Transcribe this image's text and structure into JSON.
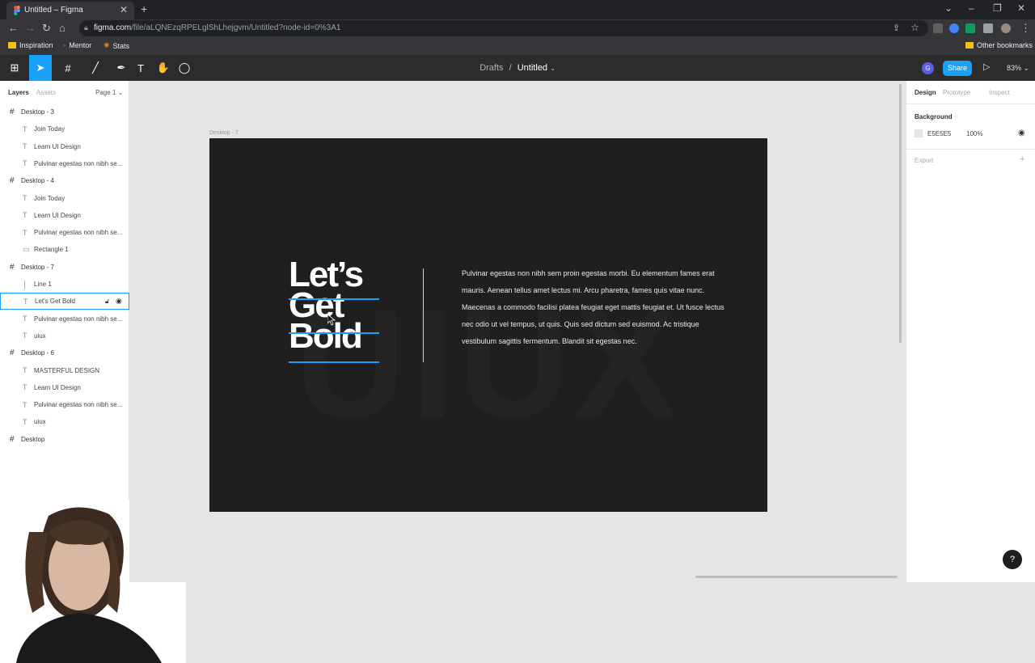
{
  "browser": {
    "tab_title": "Untitled – Figma",
    "url_host": "figma.com",
    "url_path": "/file/aLQNEzqRPELglShLhejgvm/Untitled?node-id=0%3A1",
    "bookmarks": [
      "Inspiration",
      "Mentor",
      "Stats"
    ],
    "other_bookmarks": "Other bookmarks"
  },
  "toolbar": {
    "drafts": "Drafts",
    "separator": "/",
    "file_name": "Untitled",
    "avatar_letter": "G",
    "share_label": "Share",
    "zoom": "83%"
  },
  "left_panel": {
    "tabs": [
      "Layers",
      "Assets"
    ],
    "page": "Page 1",
    "layers": [
      {
        "kind": "frame",
        "label": "Desktop - 3"
      },
      {
        "kind": "text",
        "label": "Join Today"
      },
      {
        "kind": "text",
        "label": "Learn UI Design"
      },
      {
        "kind": "text",
        "label": "Pulvinar egestas non nibh se..."
      },
      {
        "kind": "frame",
        "label": "Desktop - 4"
      },
      {
        "kind": "text",
        "label": "Join Today"
      },
      {
        "kind": "text",
        "label": "Learn UI Design"
      },
      {
        "kind": "text",
        "label": "Pulvinar egestas non nibh se..."
      },
      {
        "kind": "rect",
        "label": "Rectangle 1"
      },
      {
        "kind": "frame",
        "label": "Desktop - 7"
      },
      {
        "kind": "line",
        "label": "Line 1"
      },
      {
        "kind": "text",
        "label": "Let's Get Bold",
        "selected": true
      },
      {
        "kind": "text",
        "label": "Pulvinar egestas non nibh se..."
      },
      {
        "kind": "text",
        "label": "uiux"
      },
      {
        "kind": "frame",
        "label": "Desktop - 6"
      },
      {
        "kind": "text",
        "label": "MASTERFUL DESIGN"
      },
      {
        "kind": "text",
        "label": "Learn UI Design"
      },
      {
        "kind": "text",
        "label": "Pulvinar egestas non nibh se..."
      },
      {
        "kind": "text",
        "label": "uiux"
      },
      {
        "kind": "frame",
        "label": "Desktop"
      }
    ]
  },
  "canvas": {
    "frame_label": "Desktop - 7",
    "bg_word": "UIUX",
    "headline_lines": [
      "Let’s",
      "Get",
      "Bold"
    ],
    "body": "Pulvinar egestas non nibh sem proin egestas morbi. Eu elementum fames erat mauris. Aenean tellus amet lectus mi. Arcu pharetra, fames quis vitae nunc. Maecenas a commodo facilisi platea feugiat eget mattis feugiat et. Ut fusce lectus nec odio ut vel tempus, ut quis. Quis sed dictum sed euismod. Ac tristique vestibulum sagittis fermentum. Blandit sit egestas nec."
  },
  "right_panel": {
    "tabs": [
      "Design",
      "Prototype",
      "Inspect"
    ],
    "background_label": "Background",
    "bg_hex": "E5E5E5",
    "bg_opacity": "100%",
    "export_label": "Export",
    "add_symbol": "+"
  },
  "help_symbol": "?",
  "colors": {
    "accent": "#18a0fb",
    "canvas": "#e5e5e5",
    "frame": "#1f1f1f",
    "toolbar": "#2c2c2c"
  }
}
